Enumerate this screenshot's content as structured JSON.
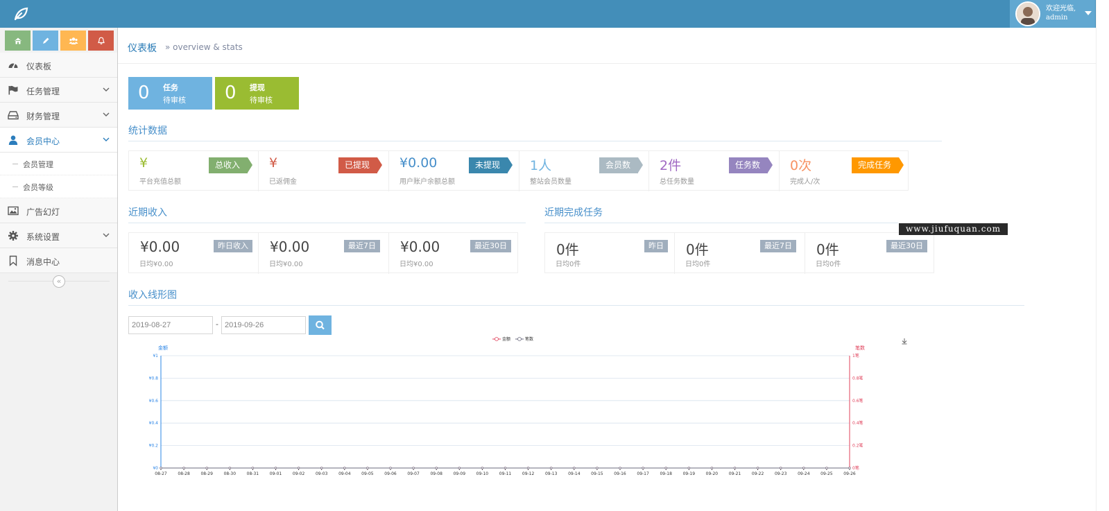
{
  "header": {
    "welcome": "欢迎光临,",
    "username": "admin"
  },
  "colors": {
    "navbar": "#438eb9",
    "success": "#87b87f",
    "info": "#6fb3e0",
    "warning": "#ffb752",
    "danger": "#d15b47"
  },
  "shortcuts": [
    {
      "icon": "home-icon",
      "color": "#87b87f"
    },
    {
      "icon": "pencil-icon",
      "color": "#6fb3e0"
    },
    {
      "icon": "users-icon",
      "color": "#ffb752"
    },
    {
      "icon": "bell-icon",
      "color": "#d15b47"
    }
  ],
  "sidebar": {
    "items": [
      {
        "label": "仪表板",
        "icon": "dashboard-icon"
      },
      {
        "label": "任务管理",
        "icon": "flag-icon"
      },
      {
        "label": "财务管理",
        "icon": "drive-icon"
      },
      {
        "label": "会员中心",
        "icon": "user-icon"
      },
      {
        "label": "广告幻灯",
        "icon": "picture-icon"
      },
      {
        "label": "系统设置",
        "icon": "cog-icon"
      },
      {
        "label": "消息中心",
        "icon": "bookmark-icon"
      }
    ],
    "sub_items": [
      {
        "label": "会员管理"
      },
      {
        "label": "会员等级"
      }
    ]
  },
  "breadcrumb": {
    "title": "仪表板",
    "subtitle": "» overview & stats"
  },
  "pending": [
    {
      "count": "0",
      "title": "任务",
      "status": "待审核",
      "color": "#6fb3e0"
    },
    {
      "count": "0",
      "title": "提现",
      "status": "待审核",
      "color": "#9abc32"
    }
  ],
  "sections": {
    "stats": "统计数据",
    "income": "近期收入",
    "tasks": "近期完成任务",
    "chart": "收入线形图"
  },
  "stats": [
    {
      "value": "¥",
      "label": "平台充值总额",
      "badge": "总收入",
      "color": "#82af6f",
      "valcolor": "#9abc32"
    },
    {
      "value": "¥",
      "label": "已返佣金",
      "badge": "已提现",
      "color": "#d15b47",
      "valcolor": "#d15b47"
    },
    {
      "value": "¥0.00",
      "label": "用户账户余额总额",
      "badge": "未提现",
      "color": "#3a87ad",
      "valcolor": "#478fca"
    },
    {
      "value": "1人",
      "label": "整站会员数量",
      "badge": "会员数",
      "color": "#abbac3",
      "valcolor": "#6fb3e0"
    },
    {
      "value": "2件",
      "label": "总任务数量",
      "badge": "任务数",
      "color": "#9585bf",
      "valcolor": "#a069c3"
    },
    {
      "value": "0次",
      "label": "完成人/次",
      "badge": "完成任务",
      "color": "#ff9800",
      "valcolor": "#f79263"
    }
  ],
  "income": [
    {
      "value": "¥0.00",
      "sub": "日均¥0.00",
      "badge": "昨日收入"
    },
    {
      "value": "¥0.00",
      "sub": "日均¥0.00",
      "badge": "最近7日"
    },
    {
      "value": "¥0.00",
      "sub": "日均¥0.00",
      "badge": "最近30日"
    }
  ],
  "tasks": [
    {
      "value": "0件",
      "sub": "日均0件",
      "badge": "昨日"
    },
    {
      "value": "0件",
      "sub": "日均0件",
      "badge": "最近7日"
    },
    {
      "value": "0件",
      "sub": "日均0件",
      "badge": "最近30日"
    }
  ],
  "date_range": {
    "start": "2019-08-27",
    "end": "2019-09-26",
    "separator": "-"
  },
  "watermark": "www.jiufuquan.com",
  "chart_data": {
    "type": "line",
    "x": [
      "08-27",
      "08-28",
      "08-29",
      "08-30",
      "08-31",
      "09-01",
      "09-02",
      "09-03",
      "09-04",
      "09-05",
      "09-06",
      "09-07",
      "09-08",
      "09-09",
      "09-10",
      "09-11",
      "09-12",
      "09-13",
      "09-14",
      "09-15",
      "09-16",
      "09-17",
      "09-18",
      "09-19",
      "09-20",
      "09-21",
      "09-22",
      "09-23",
      "09-24",
      "09-25",
      "09-26"
    ],
    "series": [
      {
        "name": "金额",
        "color": "#e0415b",
        "values": [
          0,
          0,
          0,
          0,
          0,
          0,
          0,
          0,
          0,
          0,
          0,
          0,
          0,
          0,
          0,
          0,
          0,
          0,
          0,
          0,
          0,
          0,
          0,
          0,
          0,
          0,
          0,
          0,
          0,
          0,
          0
        ]
      },
      {
        "name": "笔数",
        "color": "#6b6b7e",
        "values": [
          0,
          0,
          0,
          0,
          0,
          0,
          0,
          0,
          0,
          0,
          0,
          0,
          0,
          0,
          0,
          0,
          0,
          0,
          0,
          0,
          0,
          0,
          0,
          0,
          0,
          0,
          0,
          0,
          0,
          0,
          0
        ]
      }
    ],
    "ylabel_left": "金额",
    "ylabel_right": "笔数",
    "ylim": [
      0,
      1
    ],
    "yticks_left": [
      "¥0",
      "¥0.2",
      "¥0.4",
      "¥0.6",
      "¥0.8",
      "¥1"
    ],
    "yticks_right": [
      "0笔",
      "0.2笔",
      "0.4笔",
      "0.6笔",
      "0.8笔",
      "1笔"
    ],
    "grid": true,
    "legend": "top-center"
  }
}
